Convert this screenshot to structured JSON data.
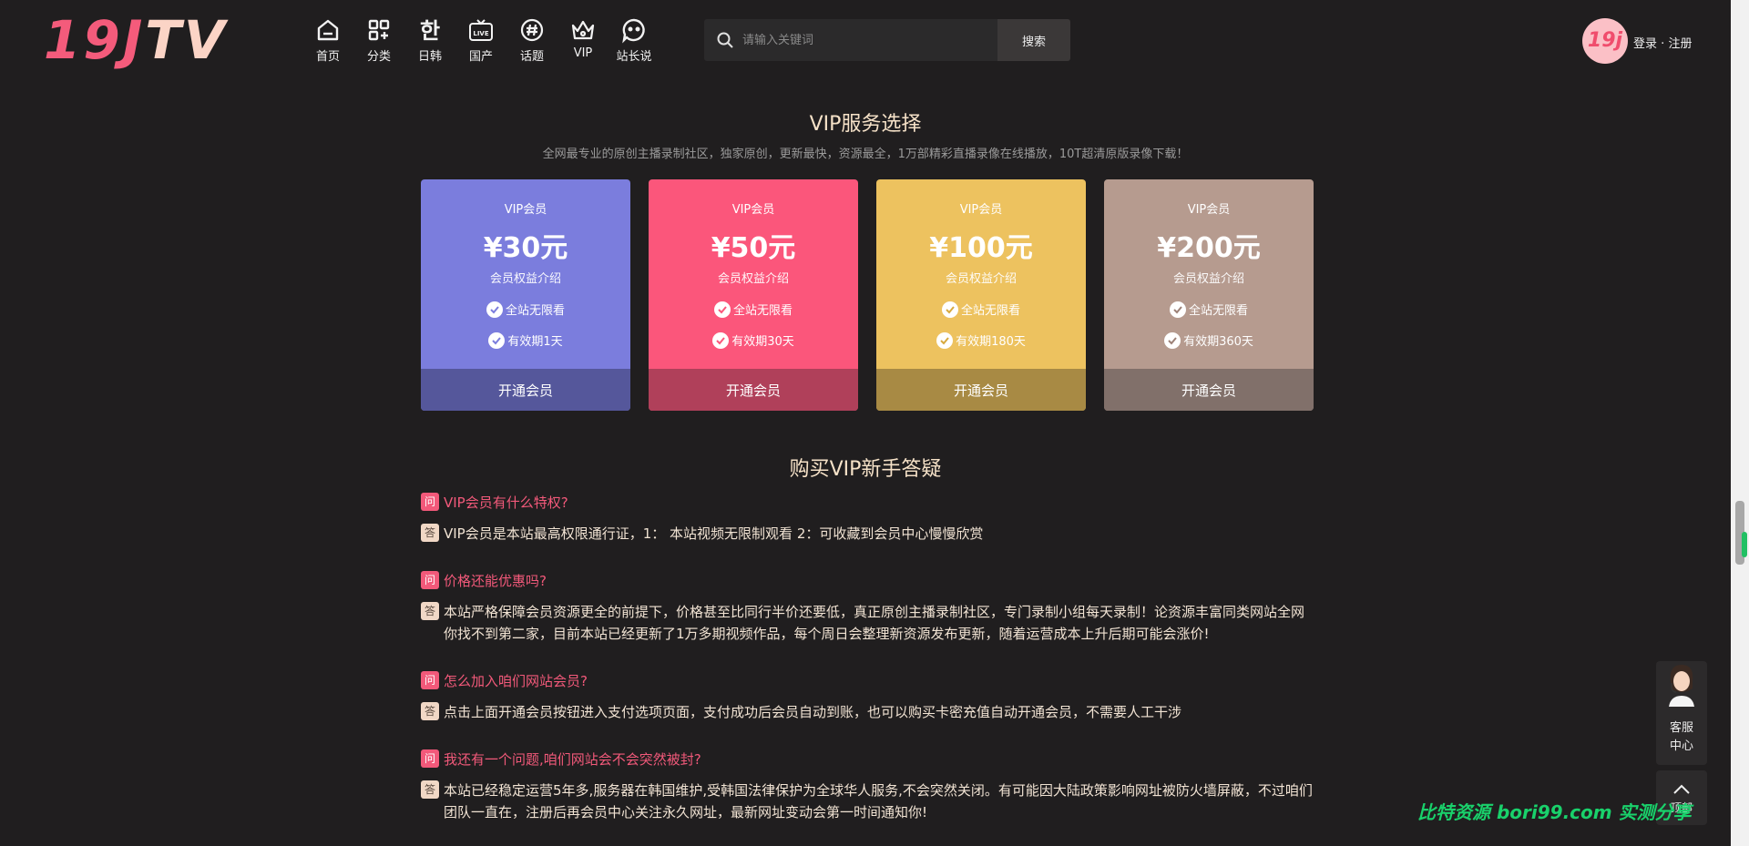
{
  "header": {
    "logo_part1": "19J",
    "logo_part2": "TV",
    "nav": [
      {
        "label": "首页",
        "icon": "home-icon"
      },
      {
        "label": "分类",
        "icon": "grid-icon"
      },
      {
        "label": "日韩",
        "icon": "hangul-icon",
        "glyph": "한"
      },
      {
        "label": "国产",
        "icon": "live-tv-icon",
        "glyph": "LIVE"
      },
      {
        "label": "话题",
        "icon": "hashtag-icon"
      },
      {
        "label": "VIP",
        "icon": "crown-icon"
      },
      {
        "label": "站长说",
        "icon": "chat-bubble-icon"
      }
    ],
    "search_placeholder": "请输入关键词",
    "search_button": "搜索",
    "avatar_text": "19j",
    "login": "登录",
    "separator": "·",
    "register": "注册"
  },
  "vip": {
    "title": "VIP服务选择",
    "subtitle": "全网最专业的原创主播录制社区，独家原创，更新最快，资源最全，1万部精彩直播录像在线播放，10T超清原版录像下载！",
    "plans": [
      {
        "tag": "VIP会员",
        "price": "¥30元",
        "intro": "会员权益介绍",
        "feature1": "全站无限看",
        "feature2": "有效期1天",
        "button": "开通会员",
        "color": "#7b7ddd",
        "button_color": "#55579b"
      },
      {
        "tag": "VIP会员",
        "price": "¥50元",
        "intro": "会员权益介绍",
        "feature1": "全站无限看",
        "feature2": "有效期30天",
        "button": "开通会员",
        "color": "#fb567b",
        "button_color": "#b0405a"
      },
      {
        "tag": "VIP会员",
        "price": "¥100元",
        "intro": "会员权益介绍",
        "feature1": "全站无限看",
        "feature2": "有效期180天",
        "button": "开通会员",
        "color": "#edc25f",
        "button_color": "#a88a44"
      },
      {
        "tag": "VIP会员",
        "price": "¥200元",
        "intro": "会员权益介绍",
        "feature1": "全站无限看",
        "feature2": "有效期360天",
        "button": "开通会员",
        "color": "#b69b8f",
        "button_color": "#81706a"
      }
    ]
  },
  "faq": {
    "title": "购买VIP新手答疑",
    "q_badge": "问",
    "a_badge": "答",
    "items": [
      {
        "q": "VIP会员有什么特权?",
        "a": "VIP会员是本站最高权限通行证，1： 本站视频无限制观看 2：可收藏到会员中心慢慢欣赏"
      },
      {
        "q": "价格还能优惠吗?",
        "a": "本站严格保障会员资源更全的前提下，价格甚至比同行半价还要低，真正原创主播录制社区，专门录制小组每天录制！论资源丰富同类网站全网你找不到第二家，目前本站已经更新了1万多期视频作品，每个周日会整理新资源发布更新，随着运营成本上升后期可能会涨价!"
      },
      {
        "q": "怎么加入咱们网站会员?",
        "a": "点击上面开通会员按钮进入支付选项页面，支付成功后会员自动到账，也可以购买卡密充值自动开通会员，不需要人工干涉"
      },
      {
        "q": "我还有一个问题,咱们网站会不会突然被封?",
        "a": "本站已经稳定运营5年多,服务器在韩国维护,受韩国法律保护为全球华人服务,不会突然关闭。有可能因大陆政策影响网址被防火墙屏蔽，不过咱们团队一直在，注册后再会员中心关注永久网址，最新网址变动会第一时间通知你!"
      }
    ]
  },
  "widgets": {
    "kefu_line1": "客服",
    "kefu_line2": "中心",
    "top_label": "顶部",
    "watermark": "比特资源 bori99.com 实测分享"
  },
  "colors": {
    "background": "#201e1f",
    "accent_pink": "#f2597a",
    "title_cream": "#f6e2c8"
  }
}
